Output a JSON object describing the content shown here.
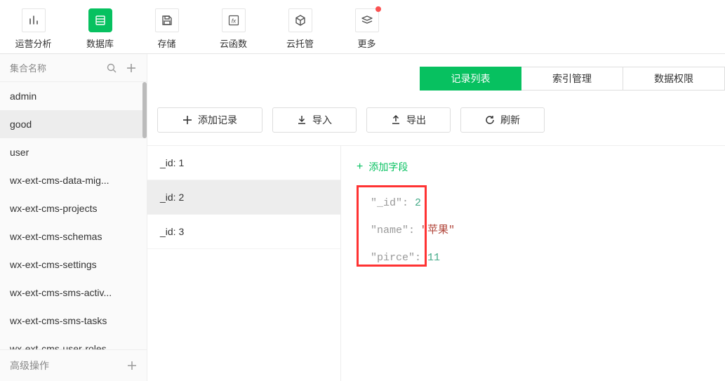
{
  "topnav": {
    "items": [
      {
        "label": "运营分析",
        "icon": "bars"
      },
      {
        "label": "数据库",
        "icon": "db",
        "active": true
      },
      {
        "label": "存储",
        "icon": "save"
      },
      {
        "label": "云函数",
        "icon": "fx"
      },
      {
        "label": "云托管",
        "icon": "cube"
      },
      {
        "label": "更多",
        "icon": "stack",
        "badge": true
      }
    ]
  },
  "sidebar": {
    "title": "集合名称",
    "items": [
      "admin",
      "good",
      "user",
      "wx-ext-cms-data-mig...",
      "wx-ext-cms-projects",
      "wx-ext-cms-schemas",
      "wx-ext-cms-settings",
      "wx-ext-cms-sms-activ...",
      "wx-ext-cms-sms-tasks",
      "wx-ext-cms-user-roles"
    ],
    "selected_index": 1,
    "advanced_label": "高级操作"
  },
  "tabs": {
    "items": [
      "记录列表",
      "索引管理",
      "数据权限"
    ],
    "active_index": 0
  },
  "toolbar": {
    "add_label": "添加记录",
    "import_label": "导入",
    "export_label": "导出",
    "refresh_label": "刷新"
  },
  "records": {
    "items": [
      "_id: 1",
      "_id: 2",
      "_id: 3"
    ],
    "selected_index": 1
  },
  "detail": {
    "add_field_label": "添加字段",
    "fields": [
      {
        "key": "\"_id\"",
        "value": "2",
        "type": "num"
      },
      {
        "key": "\"name\"",
        "value": "\"苹果\"",
        "type": "str"
      },
      {
        "key": "\"pirce\"",
        "value": "11",
        "type": "num"
      }
    ]
  }
}
